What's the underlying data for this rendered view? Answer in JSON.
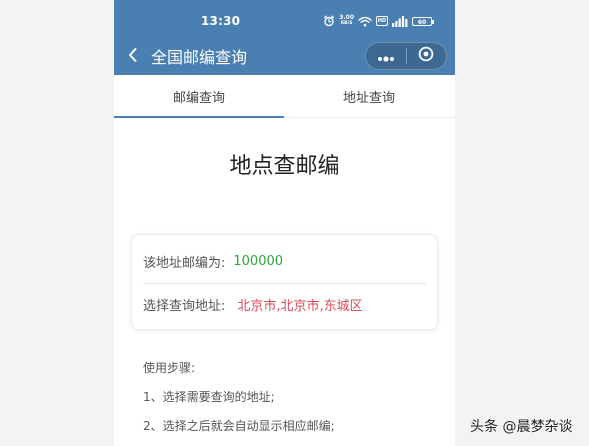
{
  "colors": {
    "brand": "#4a7fb2",
    "postcode_value": "#2ca53c",
    "address_value": "#d84c56"
  },
  "status_bar": {
    "time": "13:30",
    "net_speed": "3.00",
    "net_unit": "KB/S",
    "hd": "HD",
    "battery": "60",
    "icons": [
      "alarm-icon",
      "wifi-icon",
      "signal-icon",
      "battery-icon"
    ]
  },
  "nav": {
    "back_icon": "chevron-left-icon",
    "title": "全国邮编查询",
    "capsule": {
      "more_icon": "more-dots-icon",
      "close_icon": "target-close-icon"
    }
  },
  "tabs": [
    {
      "label": "邮编查询",
      "active": true
    },
    {
      "label": "地址查询",
      "active": false
    }
  ],
  "main": {
    "title": "地点查邮编",
    "result_card": {
      "postcode_label": "该地址邮编为:",
      "postcode_value": "100000",
      "address_label": "选择查询地址:",
      "address_value": "北京市,北京市,东城区"
    },
    "steps": [
      "使用步骤:",
      "1、选择需要查询的地址;",
      "2、选择之后就会自动显示相应邮编;"
    ]
  },
  "watermark": {
    "text": "头条 @晨梦杂谈"
  }
}
